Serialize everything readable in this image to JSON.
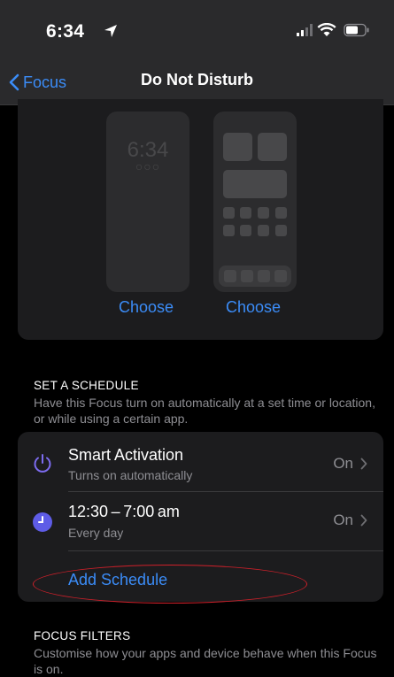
{
  "status_bar": {
    "time": "6:34",
    "icons": [
      "location-arrow-icon",
      "cellular-signal-icon",
      "wifi-icon",
      "battery-icon"
    ]
  },
  "nav": {
    "back_label": "Focus",
    "title": "Do Not Disturb"
  },
  "wallpaper": {
    "lock_preview_time": "6:34",
    "lock_preview_dots": "○○○",
    "lock_choose_label": "Choose",
    "home_choose_label": "Choose"
  },
  "schedule_section": {
    "header": "SET A SCHEDULE",
    "description": "Have this Focus turn on automatically at a set time or location, or while using a certain app.",
    "rows": [
      {
        "icon": "power-icon",
        "title": "Smart Activation",
        "subtitle": "Turns on automatically",
        "value": "On"
      },
      {
        "icon": "clock-icon",
        "title": "12:30 – 7:00 am",
        "subtitle": "Every day",
        "value": "On"
      }
    ],
    "add_label": "Add Schedule"
  },
  "filters_section": {
    "header": "FOCUS FILTERS",
    "description": "Customise how your apps and device behave when this Focus is on."
  },
  "colors": {
    "accent": "#3b8cf7",
    "power_icon": "#7d6cf0",
    "clock_icon": "#5e5ce6",
    "annotation": "#d0202a"
  }
}
